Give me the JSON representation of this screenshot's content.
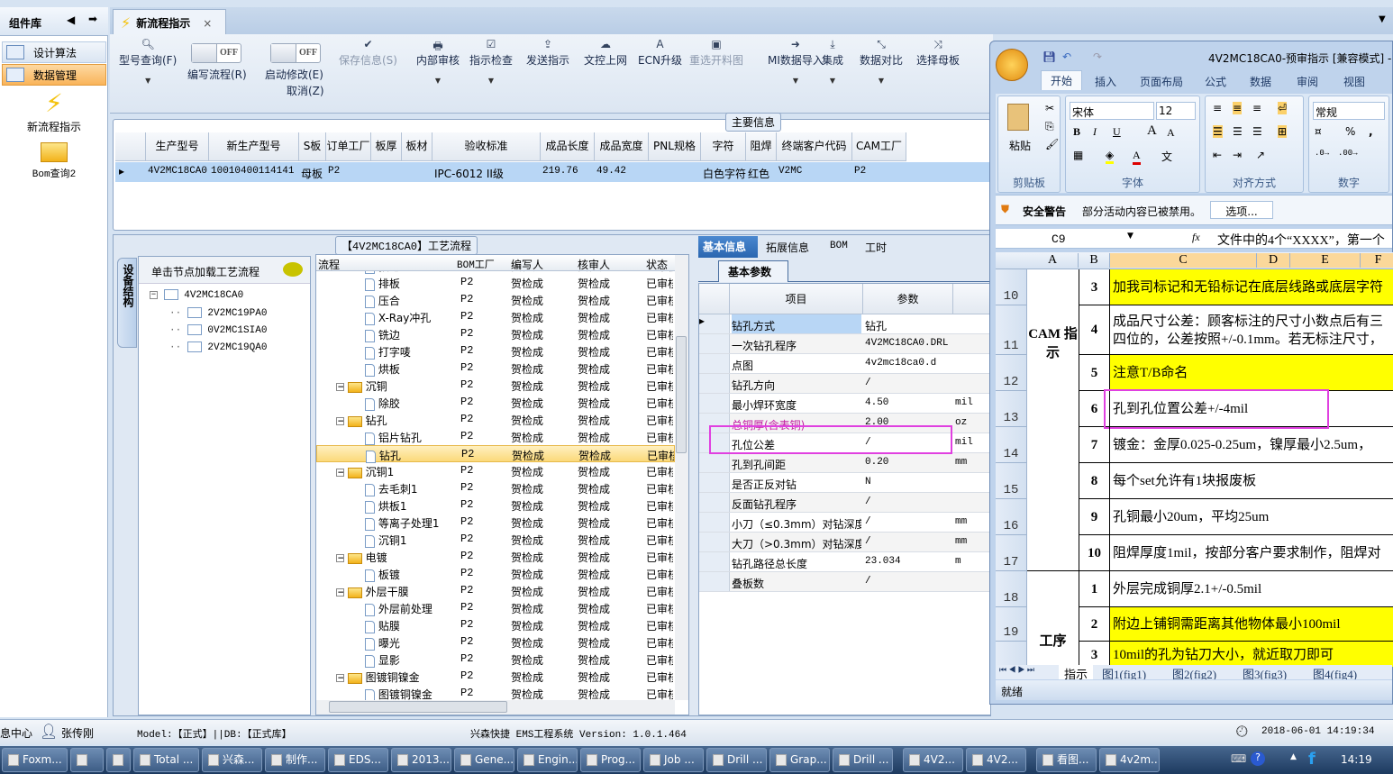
{
  "sidebar": {
    "title": "组件库",
    "items": [
      {
        "label": "设计算法"
      },
      {
        "label": "数据管理"
      }
    ],
    "tools": [
      {
        "label": "新流程指示"
      },
      {
        "label": "Bom查询2"
      }
    ]
  },
  "tab": {
    "label": "新流程指示",
    "close": "×"
  },
  "toolbar": {
    "query": "型号查询(F)",
    "write_flow": "编写流程(R)",
    "start_modify": "启动修改(E)",
    "cancel": "取消(Z)",
    "off": "OFF",
    "buttons": [
      {
        "label": "保存信息(S)",
        "glyph": "✔",
        "disabled": true
      },
      {
        "label": "内部审核",
        "glyph": "🖶"
      },
      {
        "label": "指示检查",
        "glyph": "☑"
      },
      {
        "label": "发送指示",
        "glyph": "⇪"
      },
      {
        "label": "文控上网",
        "glyph": "☁"
      },
      {
        "label": "ECN升级",
        "glyph": "A"
      },
      {
        "label": "重选开料图",
        "glyph": "▣",
        "disabled": true
      },
      {
        "label": "MI数据导入",
        "glyph": "➜"
      },
      {
        "label": "集成",
        "glyph": "⤓"
      },
      {
        "label": "数据对比",
        "glyph": "⤡"
      },
      {
        "label": "选择母板",
        "glyph": "⤨"
      }
    ]
  },
  "main_info": {
    "title": "主要信息",
    "columns": [
      "生产型号",
      "新生产型号",
      "S板",
      "订单工厂",
      "板厚",
      "板材",
      "验收标准",
      "成品长度",
      "成品宽度",
      "PNL规格",
      "字符",
      "阻焊",
      "终端客户代码",
      "CAM工厂"
    ],
    "row": [
      "4V2MC18CA0",
      "10010400114141",
      "母板",
      "P2",
      "",
      "",
      "IPC-6012 II级",
      "219.76",
      "49.42",
      "",
      "白色字符",
      "红色",
      "V2MC",
      "P2"
    ]
  },
  "flow_section": {
    "title": "【4V2MC18CA0】工艺流程"
  },
  "structure": {
    "tab": "设备结构",
    "hint": "单击节点加载工艺流程",
    "root": "4V2MC18CA0",
    "children": [
      "2V2MC19PA0",
      "0V2MC1SIA0",
      "2V2MC19QA0"
    ]
  },
  "process": {
    "columns": [
      "流程",
      "BOM工厂",
      "编写人",
      "核审人",
      "状态"
    ],
    "rows": [
      {
        "name": "预排",
        "level": 2
      },
      {
        "name": "排板",
        "level": 2
      },
      {
        "name": "压合",
        "level": 2
      },
      {
        "name": "X-Ray冲孔",
        "level": 2
      },
      {
        "name": "铣边",
        "level": 2
      },
      {
        "name": "打字唛",
        "level": 2
      },
      {
        "name": "烘板",
        "level": 2
      },
      {
        "name": "沉铜",
        "level": 1
      },
      {
        "name": "除胶",
        "level": 2
      },
      {
        "name": "钻孔",
        "level": 1
      },
      {
        "name": "铝片钻孔",
        "level": 2
      },
      {
        "name": "钻孔",
        "level": 2,
        "selected": true
      },
      {
        "name": "沉铜1",
        "level": 1
      },
      {
        "name": "去毛刺1",
        "level": 2
      },
      {
        "name": "烘板1",
        "level": 2
      },
      {
        "name": "等离子处理1",
        "level": 2
      },
      {
        "name": "沉铜1",
        "level": 2
      },
      {
        "name": "电镀",
        "level": 1
      },
      {
        "name": "板镀",
        "level": 2
      },
      {
        "name": "外层干膜",
        "level": 1
      },
      {
        "name": "外层前处理",
        "level": 2
      },
      {
        "name": "贴膜",
        "level": 2
      },
      {
        "name": "曝光",
        "level": 2
      },
      {
        "name": "显影",
        "level": 2
      },
      {
        "name": "图镀铜镍金",
        "level": 1
      },
      {
        "name": "图镀铜镍金",
        "level": 2
      }
    ],
    "factory": "P2",
    "writer": "贺检成",
    "reviewer": "贺检成",
    "status": "已审核"
  },
  "params": {
    "tabs": [
      "基本信息",
      "拓展信息",
      "BOM",
      "工时"
    ],
    "subtab": "基本参数",
    "columns": [
      "项目",
      "参数"
    ],
    "rows": [
      {
        "item": "钻孔方式",
        "value": "钻孔",
        "unit": ""
      },
      {
        "item": "一次钻孔程序",
        "value": "4V2MC18CA0.DRL",
        "unit": ""
      },
      {
        "item": "点图",
        "value": "4v2mc18ca0.d",
        "unit": ""
      },
      {
        "item": "钻孔方向",
        "value": "/",
        "unit": ""
      },
      {
        "item": "最小焊环宽度",
        "value": "4.50",
        "unit": "mil"
      },
      {
        "item": "总铜厚(含表铜)",
        "value": "2.00",
        "unit": "oz",
        "warn": true
      },
      {
        "item": "孔位公差",
        "value": "/",
        "unit": "mil",
        "highlight": true
      },
      {
        "item": "孔到孔间距",
        "value": "0.20",
        "unit": "mm"
      },
      {
        "item": "是否正反对钻",
        "value": "N",
        "unit": ""
      },
      {
        "item": "反面钻孔程序",
        "value": "/",
        "unit": ""
      },
      {
        "item": "小刀（≤0.3mm）对钻深度",
        "value": "/",
        "unit": "mm"
      },
      {
        "item": "大刀（>0.3mm）对钻深度",
        "value": "/",
        "unit": "mm"
      },
      {
        "item": "钻孔路径总长度",
        "value": "23.034",
        "unit": "m"
      },
      {
        "item": "叠板数",
        "value": "/",
        "unit": ""
      }
    ]
  },
  "excel": {
    "title": "4V2MC18CA0-预审指示 [兼容模式] -",
    "ribbon_tabs": [
      "开始",
      "插入",
      "页面布局",
      "公式",
      "数据",
      "审阅",
      "视图"
    ],
    "groups": {
      "clipboard": "剪贴板",
      "paste": "粘贴",
      "font": "字体",
      "align": "对齐方式",
      "number": "数字"
    },
    "font_name": "宋体",
    "font_size": "12",
    "number_format": "常规",
    "security": {
      "title": "安全警告",
      "message": "部分活动内容已被禁用。",
      "button": "选项..."
    },
    "name_box": "C9",
    "formula": "文件中的4个“XXXX”，第一个",
    "col_headers": [
      "A",
      "B",
      "C",
      "D",
      "E",
      "F"
    ],
    "cam_label": "CAM 指示",
    "proc_label": "工序",
    "rows": [
      {
        "num": "10",
        "b": "3",
        "c": "加我司标记和无铅标记在底层线路或底层字符",
        "yellow": true
      },
      {
        "num": "11",
        "b": "4",
        "c": "成品尺寸公差：顾客标注的尺寸小数点后有三",
        "c2": "四位的，公差按照+/-0.1mm。若无标注尺寸，"
      },
      {
        "num": "12",
        "b": "5",
        "c": "注意T/B命名",
        "yellow": true
      },
      {
        "num": "13",
        "b": "6",
        "c": "孔到孔位置公差+/-4mil",
        "highlight": true
      },
      {
        "num": "14",
        "b": "7",
        "c": "镀金：金厚0.025-0.25um，镍厚最小2.5um，"
      },
      {
        "num": "15",
        "b": "8",
        "c": "每个set允许有1块报废板"
      },
      {
        "num": "16",
        "b": "9",
        "c": "孔铜最小20um，平均25um"
      },
      {
        "num": "17",
        "b": "10",
        "c": "阻焊厚度1mil，按部分客户要求制作，阻焊对"
      },
      {
        "num": "18",
        "b": "1",
        "c": "外层完成铜厚2.1+/-0.5mil"
      },
      {
        "num": "19",
        "b": "2",
        "c": "附边上铺铜需距离其他物体最小100mil",
        "yellow": true
      },
      {
        "num": "",
        "b": "3",
        "c": "10mil的孔为钻刀大小，就近取刀即可",
        "yellow": true
      }
    ],
    "sheets": [
      "指示",
      "图1(fig1)",
      "图2(fig2)",
      "图3(fig3)",
      "图4(fig4)"
    ],
    "status": "就绪"
  },
  "statusbar": {
    "left": "息中心",
    "user": "张传刚",
    "model": "Model:【正式】||DB:【正式库】",
    "system": "兴森快捷 EMS工程系统 Version: 1.0.1.464",
    "datetime": "2018-06-01 14:19:34"
  },
  "taskbar": {
    "items": [
      "Foxm...",
      "",
      "",
      "Total ...",
      "兴森...",
      "制作...",
      "EDS...",
      "2013...",
      "Gene...",
      "Engin...",
      "Prog...",
      "Job ...",
      "Drill ...",
      "Grap...",
      "Drill ...",
      "4V2...",
      "4V2...",
      "看图...",
      "4v2m..."
    ],
    "clock": "14:19"
  },
  "colors": {
    "accent": "#f9b45a",
    "highlight": "#e040e0",
    "yellow": "#ffff00",
    "selection": "#b8d6f5"
  }
}
